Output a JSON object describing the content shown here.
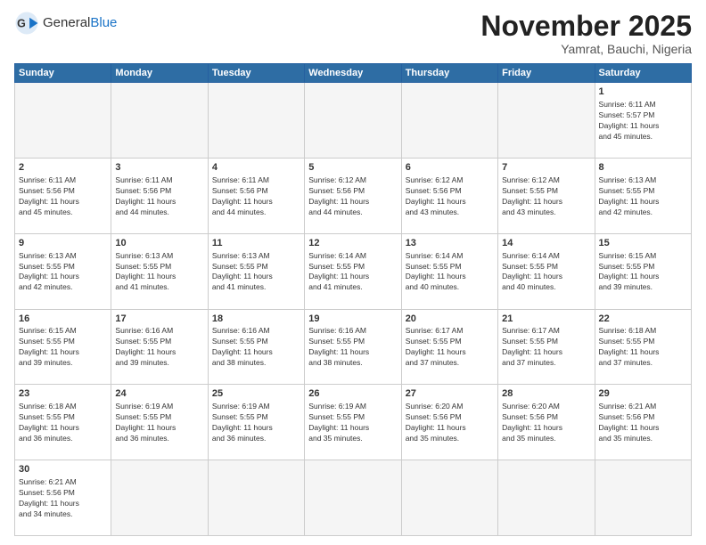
{
  "header": {
    "logo_general": "General",
    "logo_blue": "Blue",
    "month": "November 2025",
    "location": "Yamrat, Bauchi, Nigeria"
  },
  "days_of_week": [
    "Sunday",
    "Monday",
    "Tuesday",
    "Wednesday",
    "Thursday",
    "Friday",
    "Saturday"
  ],
  "weeks": [
    [
      {
        "day": null,
        "info": null
      },
      {
        "day": null,
        "info": null
      },
      {
        "day": null,
        "info": null
      },
      {
        "day": null,
        "info": null
      },
      {
        "day": null,
        "info": null
      },
      {
        "day": null,
        "info": null
      },
      {
        "day": "1",
        "info": "Sunrise: 6:11 AM\nSunset: 5:57 PM\nDaylight: 11 hours\nand 45 minutes."
      }
    ],
    [
      {
        "day": "2",
        "info": "Sunrise: 6:11 AM\nSunset: 5:56 PM\nDaylight: 11 hours\nand 45 minutes."
      },
      {
        "day": "3",
        "info": "Sunrise: 6:11 AM\nSunset: 5:56 PM\nDaylight: 11 hours\nand 44 minutes."
      },
      {
        "day": "4",
        "info": "Sunrise: 6:11 AM\nSunset: 5:56 PM\nDaylight: 11 hours\nand 44 minutes."
      },
      {
        "day": "5",
        "info": "Sunrise: 6:12 AM\nSunset: 5:56 PM\nDaylight: 11 hours\nand 44 minutes."
      },
      {
        "day": "6",
        "info": "Sunrise: 6:12 AM\nSunset: 5:56 PM\nDaylight: 11 hours\nand 43 minutes."
      },
      {
        "day": "7",
        "info": "Sunrise: 6:12 AM\nSunset: 5:55 PM\nDaylight: 11 hours\nand 43 minutes."
      },
      {
        "day": "8",
        "info": "Sunrise: 6:13 AM\nSunset: 5:55 PM\nDaylight: 11 hours\nand 42 minutes."
      }
    ],
    [
      {
        "day": "9",
        "info": "Sunrise: 6:13 AM\nSunset: 5:55 PM\nDaylight: 11 hours\nand 42 minutes."
      },
      {
        "day": "10",
        "info": "Sunrise: 6:13 AM\nSunset: 5:55 PM\nDaylight: 11 hours\nand 41 minutes."
      },
      {
        "day": "11",
        "info": "Sunrise: 6:13 AM\nSunset: 5:55 PM\nDaylight: 11 hours\nand 41 minutes."
      },
      {
        "day": "12",
        "info": "Sunrise: 6:14 AM\nSunset: 5:55 PM\nDaylight: 11 hours\nand 41 minutes."
      },
      {
        "day": "13",
        "info": "Sunrise: 6:14 AM\nSunset: 5:55 PM\nDaylight: 11 hours\nand 40 minutes."
      },
      {
        "day": "14",
        "info": "Sunrise: 6:14 AM\nSunset: 5:55 PM\nDaylight: 11 hours\nand 40 minutes."
      },
      {
        "day": "15",
        "info": "Sunrise: 6:15 AM\nSunset: 5:55 PM\nDaylight: 11 hours\nand 39 minutes."
      }
    ],
    [
      {
        "day": "16",
        "info": "Sunrise: 6:15 AM\nSunset: 5:55 PM\nDaylight: 11 hours\nand 39 minutes."
      },
      {
        "day": "17",
        "info": "Sunrise: 6:16 AM\nSunset: 5:55 PM\nDaylight: 11 hours\nand 39 minutes."
      },
      {
        "day": "18",
        "info": "Sunrise: 6:16 AM\nSunset: 5:55 PM\nDaylight: 11 hours\nand 38 minutes."
      },
      {
        "day": "19",
        "info": "Sunrise: 6:16 AM\nSunset: 5:55 PM\nDaylight: 11 hours\nand 38 minutes."
      },
      {
        "day": "20",
        "info": "Sunrise: 6:17 AM\nSunset: 5:55 PM\nDaylight: 11 hours\nand 37 minutes."
      },
      {
        "day": "21",
        "info": "Sunrise: 6:17 AM\nSunset: 5:55 PM\nDaylight: 11 hours\nand 37 minutes."
      },
      {
        "day": "22",
        "info": "Sunrise: 6:18 AM\nSunset: 5:55 PM\nDaylight: 11 hours\nand 37 minutes."
      }
    ],
    [
      {
        "day": "23",
        "info": "Sunrise: 6:18 AM\nSunset: 5:55 PM\nDaylight: 11 hours\nand 36 minutes."
      },
      {
        "day": "24",
        "info": "Sunrise: 6:19 AM\nSunset: 5:55 PM\nDaylight: 11 hours\nand 36 minutes."
      },
      {
        "day": "25",
        "info": "Sunrise: 6:19 AM\nSunset: 5:55 PM\nDaylight: 11 hours\nand 36 minutes."
      },
      {
        "day": "26",
        "info": "Sunrise: 6:19 AM\nSunset: 5:55 PM\nDaylight: 11 hours\nand 35 minutes."
      },
      {
        "day": "27",
        "info": "Sunrise: 6:20 AM\nSunset: 5:56 PM\nDaylight: 11 hours\nand 35 minutes."
      },
      {
        "day": "28",
        "info": "Sunrise: 6:20 AM\nSunset: 5:56 PM\nDaylight: 11 hours\nand 35 minutes."
      },
      {
        "day": "29",
        "info": "Sunrise: 6:21 AM\nSunset: 5:56 PM\nDaylight: 11 hours\nand 35 minutes."
      }
    ],
    [
      {
        "day": "30",
        "info": "Sunrise: 6:21 AM\nSunset: 5:56 PM\nDaylight: 11 hours\nand 34 minutes."
      },
      {
        "day": null,
        "info": null
      },
      {
        "day": null,
        "info": null
      },
      {
        "day": null,
        "info": null
      },
      {
        "day": null,
        "info": null
      },
      {
        "day": null,
        "info": null
      },
      {
        "day": null,
        "info": null
      }
    ]
  ]
}
